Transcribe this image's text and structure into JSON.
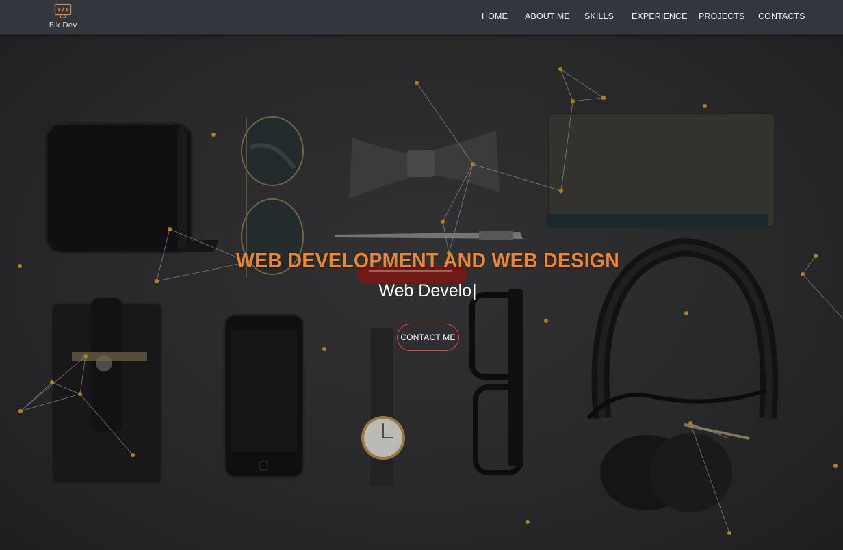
{
  "brand": {
    "logo_text": "Blk Dev",
    "icon": "monitor-code-icon",
    "accent": "#e8873a"
  },
  "nav": {
    "items": [
      {
        "label": "HOME"
      },
      {
        "label": "ABOUT ME"
      },
      {
        "label": "SKILLS"
      },
      {
        "label": "EXPERIENCE"
      },
      {
        "label": "PROJECTS"
      },
      {
        "label": "CONTACTS"
      }
    ]
  },
  "hero": {
    "title": "WEB DEVELOPMENT AND WEB DESIGN",
    "typed_text": "Web Develo",
    "cursor": "|",
    "button_label": "CONTACT ME",
    "title_color": "#e8873a",
    "button_border_color": "#e0463a",
    "particle_color": "#d9a01f"
  }
}
